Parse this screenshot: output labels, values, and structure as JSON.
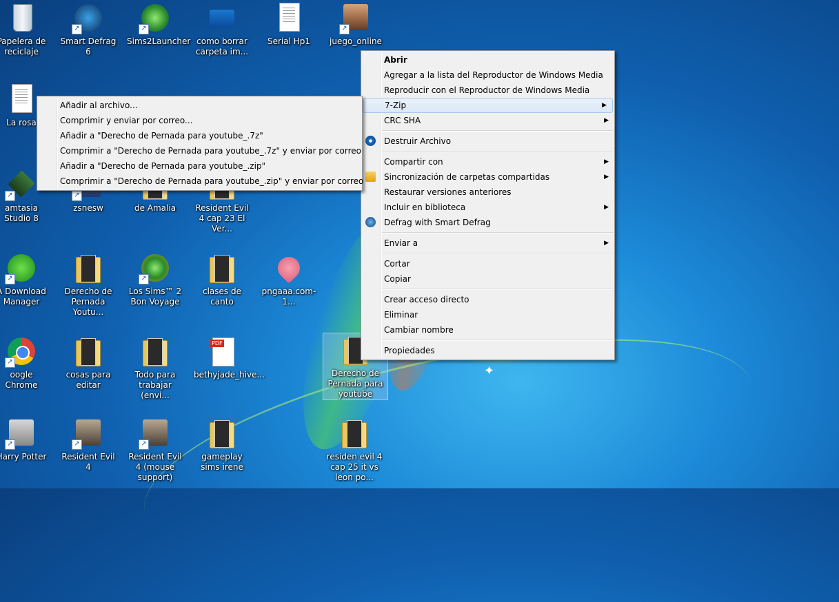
{
  "desktop": {
    "icons": [
      {
        "label": "Papelera de reciclaje"
      },
      {
        "label": "Smart Defrag 6"
      },
      {
        "label": "Sims2Launcher"
      },
      {
        "label": "como borrar carpeta im..."
      },
      {
        "label": "Serial Hp1"
      },
      {
        "label": "juego_online"
      },
      {
        "label": "La rosa"
      },
      {
        "label": "amtasia Studio 8"
      },
      {
        "label": "zsnesw"
      },
      {
        "label": "de Amalia"
      },
      {
        "label": "Resident Evil 4 cap 23 El Ver..."
      },
      {
        "label": "A Download Manager"
      },
      {
        "label": "Derecho de Pernada Youtu..."
      },
      {
        "label": "Los Sims™ 2 Bon Voyage"
      },
      {
        "label": "clases de canto"
      },
      {
        "label": "pngaaa.com-1..."
      },
      {
        "label": "oogle Chrome"
      },
      {
        "label": "cosas para editar"
      },
      {
        "label": "Todo para trabajar (envi..."
      },
      {
        "label": "bethyjade_hive..."
      },
      {
        "label": "Derecho de Pernada para youtube"
      },
      {
        "label": "Harry Potter"
      },
      {
        "label": "Resident Evil 4"
      },
      {
        "label": "Resident Evil 4 (mouse support)"
      },
      {
        "label": "gameplay sims irene"
      },
      {
        "label": "residen evil 4 cap 25 it vs leon po..."
      }
    ]
  },
  "context_menu": {
    "items": [
      {
        "label": "Abrir"
      },
      {
        "label": "Agregar a la lista del Reproductor de Windows Media"
      },
      {
        "label": "Reproducir con el Reproductor de Windows Media"
      },
      {
        "label": "7-Zip"
      },
      {
        "label": "CRC SHA"
      },
      {
        "label": "Destruir Archivo"
      },
      {
        "label": "Compartir con"
      },
      {
        "label": "Sincronización de carpetas compartidas"
      },
      {
        "label": "Restaurar versiones anteriores"
      },
      {
        "label": "Incluir en biblioteca"
      },
      {
        "label": "Defrag with Smart Defrag"
      },
      {
        "label": "Enviar a"
      },
      {
        "label": "Cortar"
      },
      {
        "label": "Copiar"
      },
      {
        "label": "Crear acceso directo"
      },
      {
        "label": "Eliminar"
      },
      {
        "label": "Cambiar nombre"
      },
      {
        "label": "Propiedades"
      }
    ]
  },
  "submenu_7zip": {
    "items": [
      {
        "label": "Añadir al archivo..."
      },
      {
        "label": "Comprimir y enviar por correo..."
      },
      {
        "label": "Añadir a \"Derecho de Pernada para youtube_.7z\""
      },
      {
        "label": "Comprimir a \"Derecho de Pernada para youtube_.7z\" y enviar por correo"
      },
      {
        "label": "Añadir a \"Derecho de Pernada para youtube_.zip\""
      },
      {
        "label": "Comprimir a \"Derecho de Pernada para youtube_.zip\" y enviar por correo"
      }
    ]
  },
  "colors": {
    "menu_bg": "#f0f0f0",
    "highlight": "#dbe8f7",
    "wallpaper": "#1c8ad8"
  }
}
